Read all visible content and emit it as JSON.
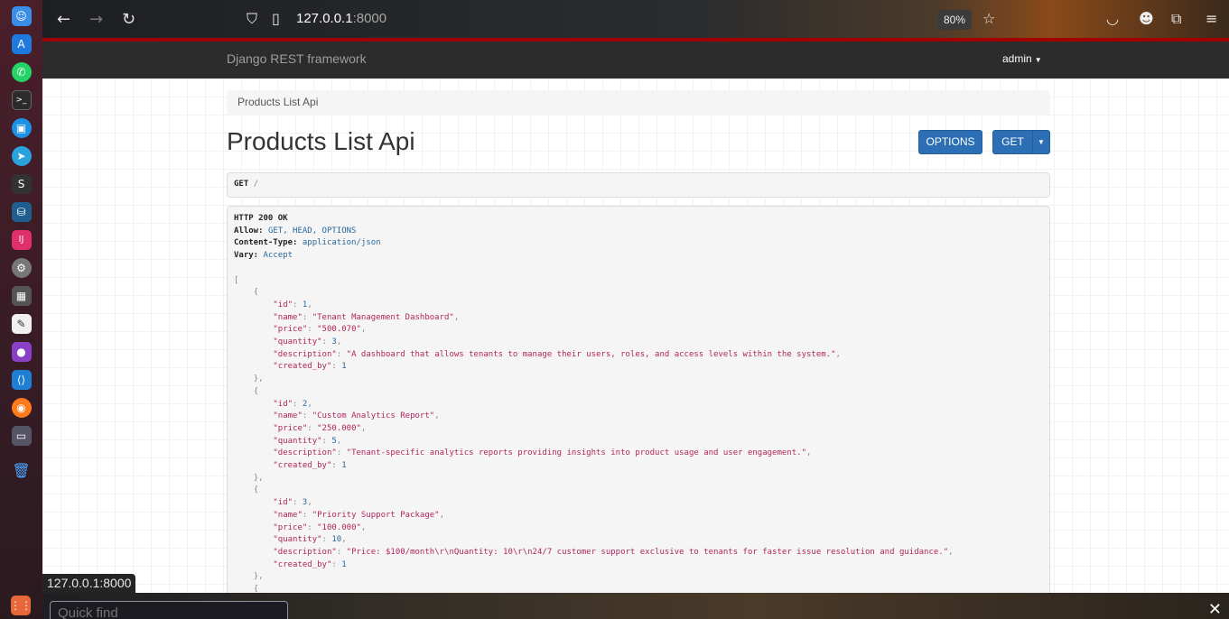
{
  "browser": {
    "url_host": "127.0.0.1",
    "url_port": ":8000",
    "zoom": "80%"
  },
  "navbar": {
    "brand": "Django REST framework",
    "user": "admin"
  },
  "breadcrumb": "Products List Api",
  "page": {
    "title": "Products List Api",
    "options_label": "OPTIONS",
    "get_label": "GET"
  },
  "request": {
    "method": "GET",
    "path": "/"
  },
  "response": {
    "status": "HTTP 200 OK",
    "headers": [
      {
        "name": "Allow:",
        "value": "GET, HEAD, OPTIONS"
      },
      {
        "name": "Content-Type:",
        "value": "application/json"
      },
      {
        "name": "Vary:",
        "value": "Accept"
      }
    ],
    "products": [
      {
        "id": 1,
        "name": "Tenant Management Dashboard",
        "price": "500.070",
        "quantity": 3,
        "description": "A dashboard that allows tenants to manage their users, roles, and access levels within the system.",
        "created_by": 1
      },
      {
        "id": 2,
        "name": "Custom Analytics Report",
        "price": "250.000",
        "quantity": 5,
        "description": "Tenant-specific analytics reports providing insights into product usage and user engagement.",
        "created_by": 1
      },
      {
        "id": 3,
        "name": "Priority Support Package",
        "price": "100.000",
        "quantity": 10,
        "description": "Price: $100/month\\r\\nQuantity: 10\\r\\n24/7 customer support exclusive to tenants for faster issue resolution and guidance.",
        "created_by": 1
      }
    ]
  },
  "status_bar": "127.0.0.1:8000",
  "findbar": {
    "placeholder": "Quick find"
  },
  "dock_icons": [
    "finder-icon",
    "app-store-icon",
    "whatsapp-icon",
    "terminal-icon",
    "docker-icon",
    "telegram-icon",
    "inkscape-icon",
    "mysql-workbench-icon",
    "intellij-icon",
    "settings-icon",
    "calculator-icon",
    "text-editor-icon",
    "screen-recorder-icon",
    "vscode-icon",
    "firefox-icon",
    "remote-desktop-icon",
    "trash-icon",
    "apps-grid-icon"
  ]
}
